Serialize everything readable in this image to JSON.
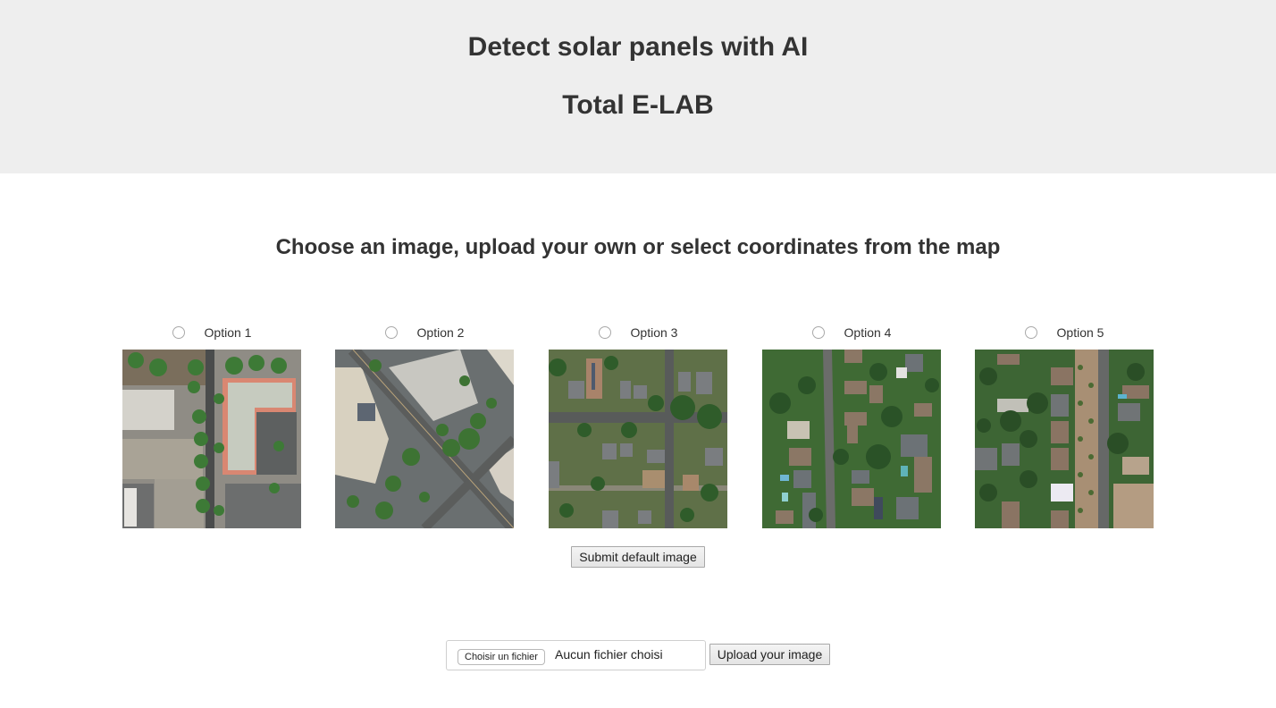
{
  "header": {
    "title": "Detect solar panels with AI",
    "subtitle": "Total E-LAB",
    "background": "#eeeeee"
  },
  "main": {
    "prompt": "Choose an image, upload your own or select coordinates from the map",
    "options": [
      {
        "label": "Option 1",
        "selected": false,
        "image": "aerial image of commercial buildings and parking lots"
      },
      {
        "label": "Option 2",
        "selected": false,
        "image": "aerial image of diagonal intersection with parking lots"
      },
      {
        "label": "Option 3",
        "selected": false,
        "image": "aerial image of residential houses at street crossing"
      },
      {
        "label": "Option 4",
        "selected": false,
        "image": "aerial image of tree-covered residential neighborhood with pools"
      },
      {
        "label": "Option 5",
        "selected": false,
        "image": "aerial image of houses beside a tree-lined road"
      }
    ],
    "submit_label": "Submit default image"
  },
  "upload": {
    "choose_file_label": "Choisir un fichier",
    "file_status": "Aucun fichier choisi",
    "upload_label": "Upload your image"
  },
  "icons": {
    "radio": "radio-button-unchecked"
  }
}
